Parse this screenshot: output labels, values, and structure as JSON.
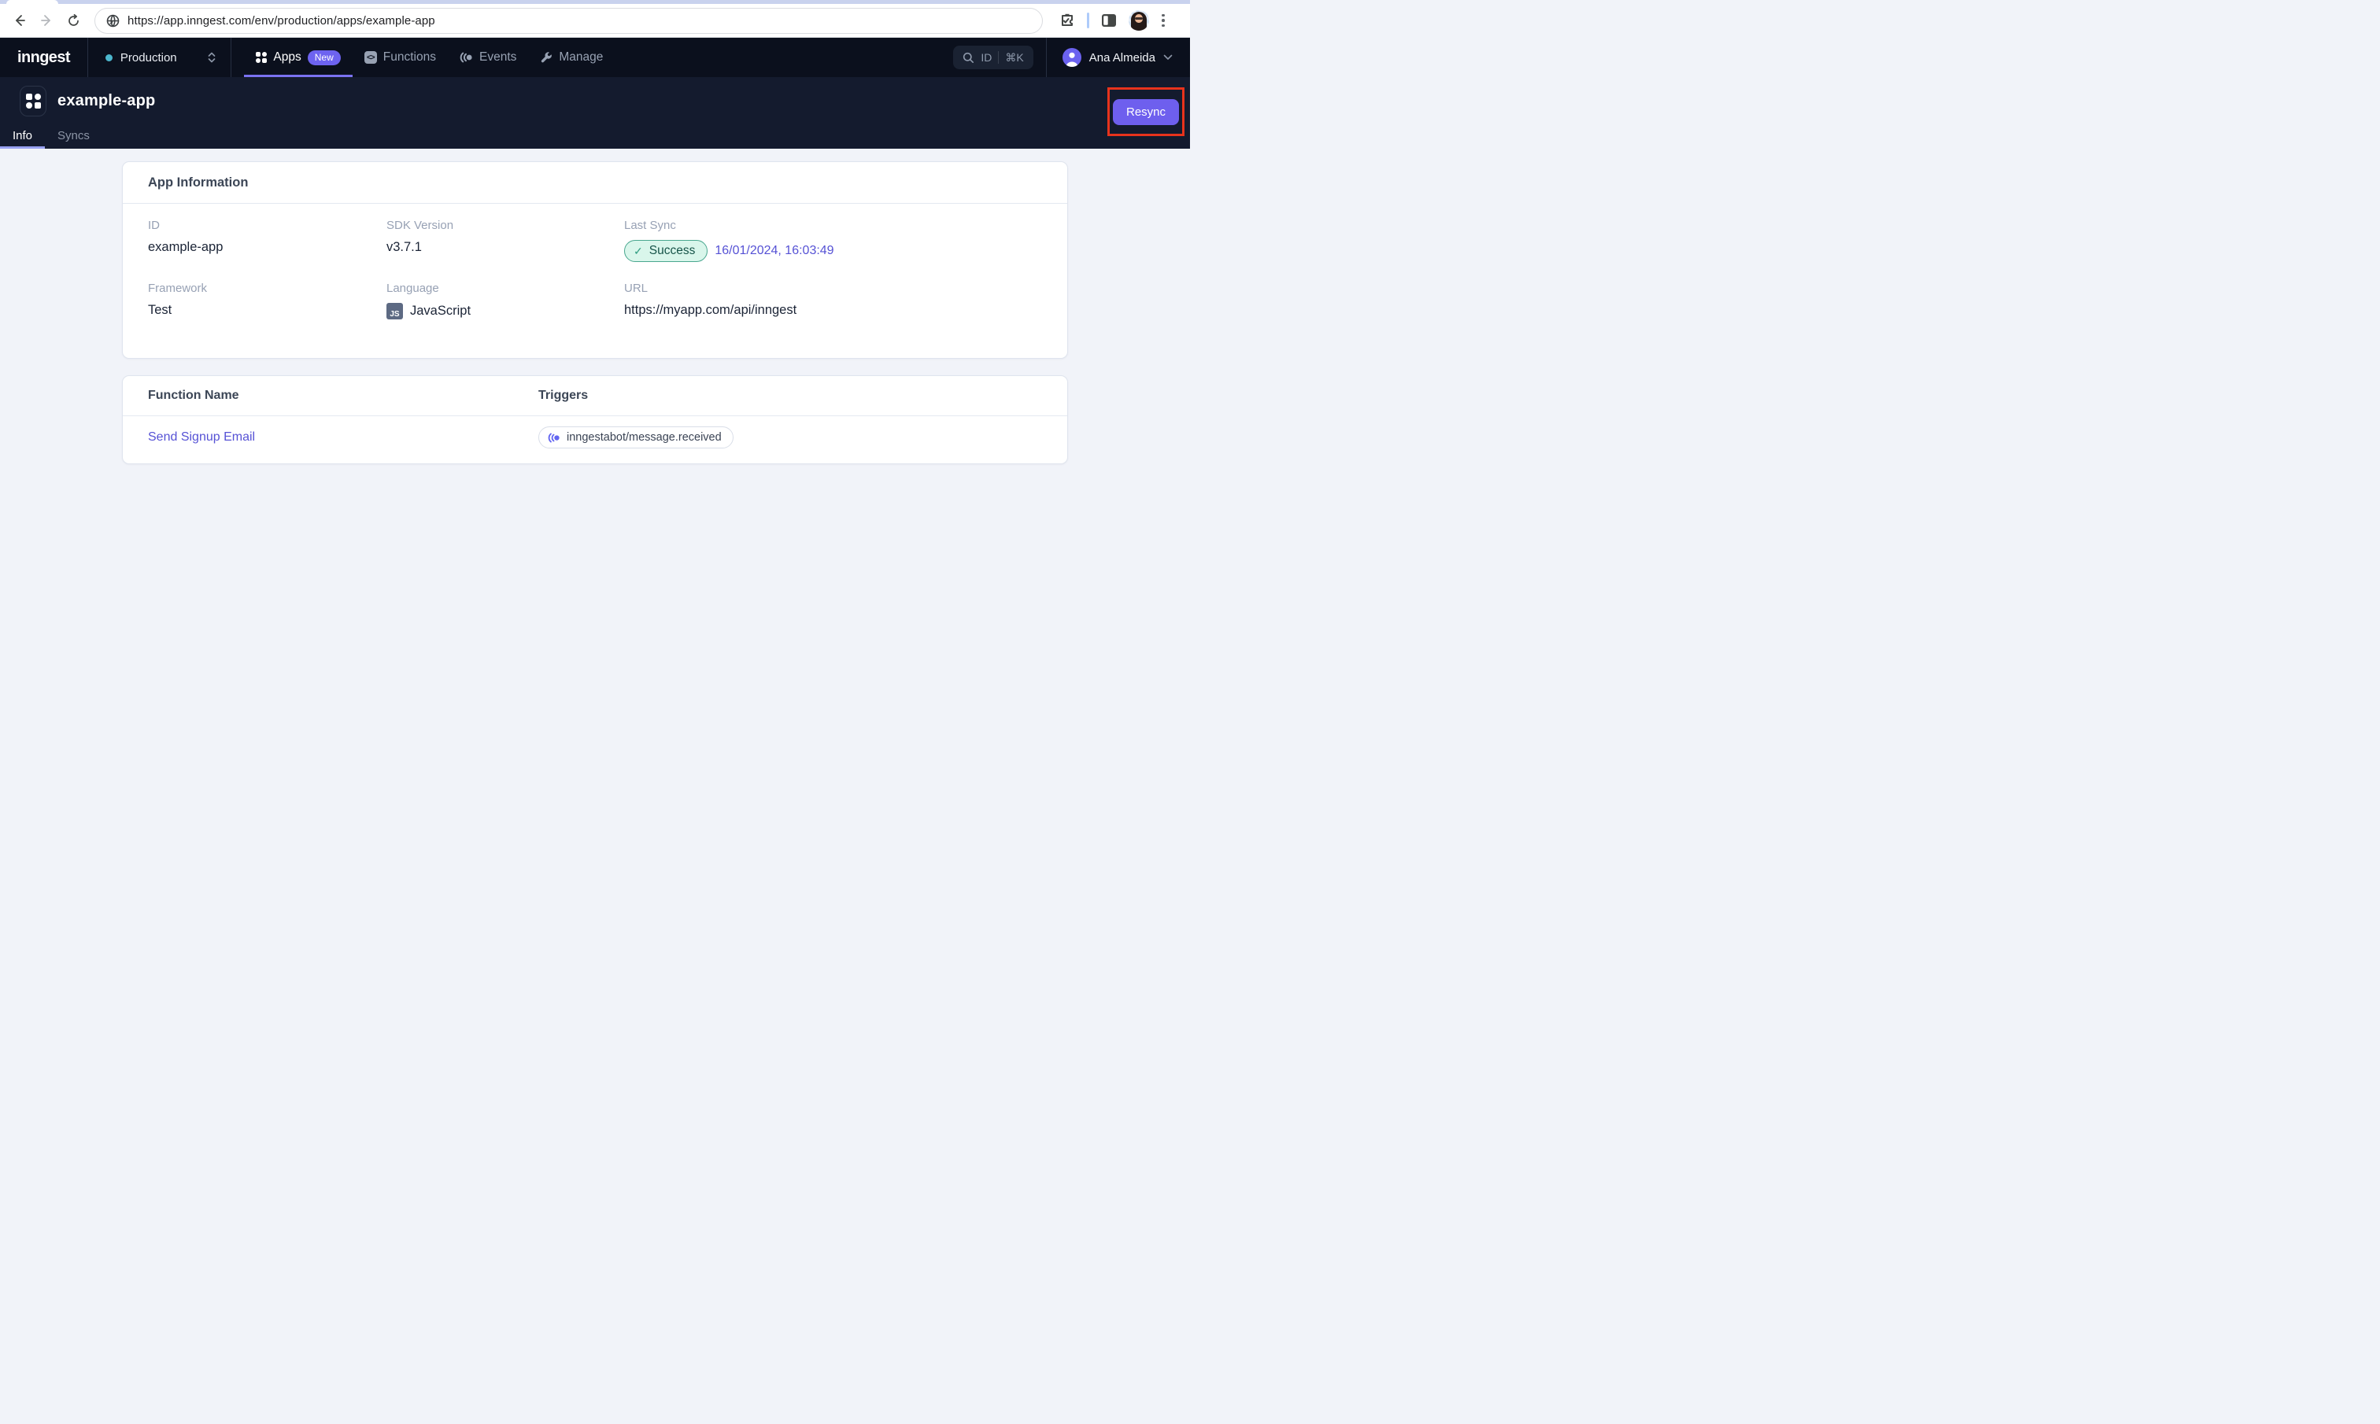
{
  "browser": {
    "url": "https://app.inngest.com/env/production/apps/example-app"
  },
  "nav": {
    "logo": "inngest",
    "environment": "Production",
    "items": [
      {
        "label": "Apps",
        "badge": "New"
      },
      {
        "label": "Functions"
      },
      {
        "label": "Events"
      },
      {
        "label": "Manage"
      }
    ],
    "search_label": "ID",
    "search_shortcut": "⌘K",
    "user_name": "Ana Almeida"
  },
  "header": {
    "app_name": "example-app",
    "tabs": [
      {
        "label": "Info"
      },
      {
        "label": "Syncs"
      }
    ],
    "resync_label": "Resync"
  },
  "app_info": {
    "title": "App Information",
    "id_label": "ID",
    "id_value": "example-app",
    "sdk_label": "SDK Version",
    "sdk_value": "v3.7.1",
    "last_sync_label": "Last Sync",
    "last_sync_status": "Success",
    "last_sync_check": "✓",
    "last_sync_date": "16/01/2024, 16:03:49",
    "framework_label": "Framework",
    "framework_value": "Test",
    "language_label": "Language",
    "language_badge": "JS",
    "language_value": "JavaScript",
    "url_label": "URL",
    "url_value": "https://myapp.com/api/inngest"
  },
  "functions_table": {
    "col_function_name": "Function Name",
    "col_triggers": "Triggers",
    "rows": [
      {
        "name": "Send Signup Email",
        "trigger": "inngestabot/message.received"
      }
    ]
  },
  "colors": {
    "accent_purple": "#6E5FEE",
    "annotation_red": "#E8331C",
    "success_green_bg": "#D9F6EB",
    "success_green_border": "#49A78F",
    "link_indigo": "#5652D5",
    "env_dot_teal": "#4CB7CE"
  }
}
